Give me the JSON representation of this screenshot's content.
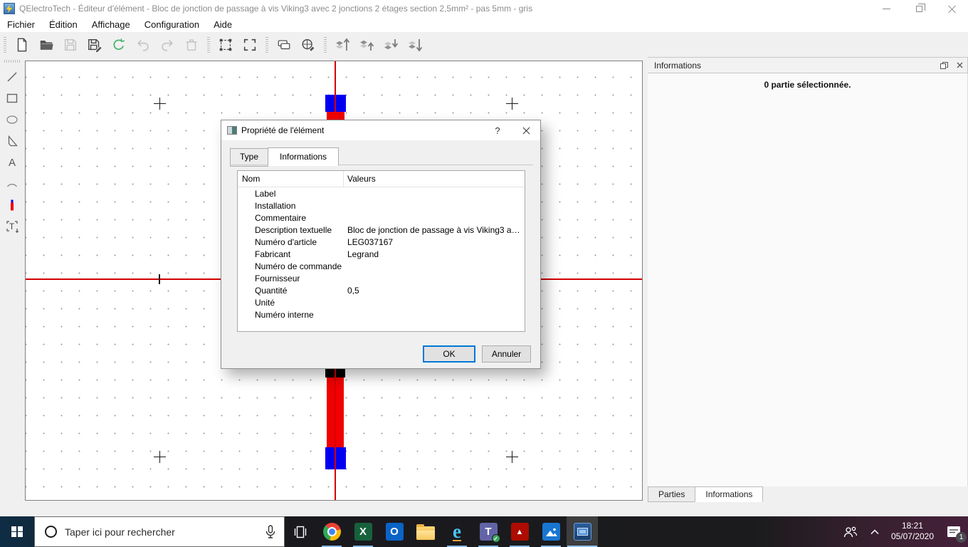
{
  "window": {
    "title": "QElectroTech - Éditeur d'élément - Bloc de jonction de passage à vis Viking3 avec 2 jonctions 2 étages section 2,5mm² - pas 5mm - gris",
    "app_icon": "qelectrotech-lightning-logo"
  },
  "menu": {
    "items": [
      "Fichier",
      "Édition",
      "Affichage",
      "Configuration",
      "Aide"
    ]
  },
  "toolbar": {
    "icons": [
      "new-element",
      "open-element",
      "save",
      "save-as",
      "reload",
      "undo",
      "redo",
      "delete",
      "edit-drawing-area",
      "adjust-area",
      "edit-names",
      "erase-drawing",
      "bring-forward",
      "raise",
      "lower",
      "send-backward"
    ]
  },
  "palette": {
    "tools": [
      "line-tool",
      "rectangle-tool",
      "ellipse-tool",
      "polygon-tool",
      "text-tool",
      "arc-tool",
      "terminal-tool",
      "dynamic-textfield-tool"
    ]
  },
  "canvas": {
    "element_colors": {
      "red": "#f00000",
      "blue": "#0000f0",
      "black": "#000000"
    },
    "axis_color": "#d40000"
  },
  "dialog": {
    "title": "Propriété de l'élément",
    "help_label": "?",
    "tabs": [
      {
        "label": "Type",
        "active": false
      },
      {
        "label": "Informations",
        "active": true
      }
    ],
    "table": {
      "headers": [
        "Nom",
        "Valeurs"
      ],
      "rows": [
        {
          "name": "Label",
          "value": ""
        },
        {
          "name": "Installation",
          "value": ""
        },
        {
          "name": "Commentaire",
          "value": ""
        },
        {
          "name": "Description textuelle",
          "value": "Bloc de jonction de passage à vis Viking3 ave..."
        },
        {
          "name": "Numéro d'article",
          "value": "LEG037167"
        },
        {
          "name": "Fabricant",
          "value": "Legrand"
        },
        {
          "name": "Numéro de commande",
          "value": ""
        },
        {
          "name": "Fournisseur",
          "value": ""
        },
        {
          "name": "Quantité",
          "value": "0,5"
        },
        {
          "name": "Unité",
          "value": ""
        },
        {
          "name": "Numéro interne",
          "value": ""
        }
      ]
    },
    "buttons": {
      "ok": "OK",
      "cancel": "Annuler"
    }
  },
  "info_panel": {
    "title": "Informations",
    "empty_text": "0 partie sélectionnée.",
    "tabs": [
      {
        "label": "Parties",
        "active": false
      },
      {
        "label": "Informations",
        "active": true
      }
    ]
  },
  "taskbar": {
    "search": {
      "placeholder": "Taper ici pour rechercher"
    },
    "apps": [
      "task-view",
      "chrome",
      "excel",
      "outlook",
      "file-explorer",
      "internet-explorer",
      "teams",
      "acrobat",
      "photos",
      "qelectrotech-active"
    ],
    "app_glyphs": {
      "excel": "X",
      "outlook": "O",
      "internet_explorer": "e",
      "teams": "T",
      "teams_check": "✓",
      "acrobat": "▲"
    },
    "tray": {
      "time": "18:21",
      "date": "05/07/2020",
      "notification_count": "1"
    }
  },
  "colors": {
    "accent_blue": "#0078d7",
    "taskbar_left": "#0e2c44",
    "taskbar_right": "#45203a",
    "underline_blue": "#85b9e6"
  }
}
